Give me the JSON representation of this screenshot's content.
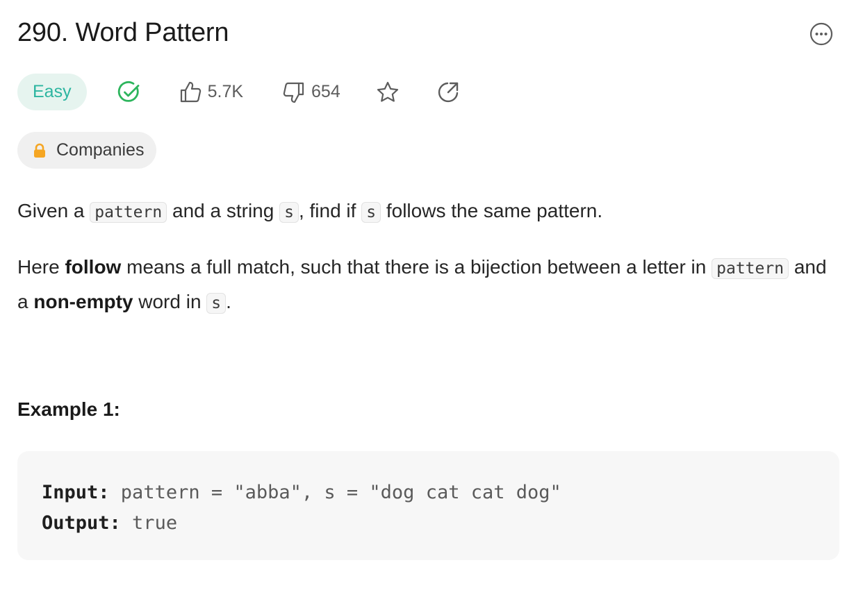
{
  "problem": {
    "title": "290. Word Pattern",
    "difficulty": "Easy",
    "likes": "5.7K",
    "dislikes": "654",
    "companies_label": "Companies"
  },
  "description": {
    "p1": {
      "t1": "Given a ",
      "c1": "pattern",
      "t2": " and a string ",
      "c2": "s",
      "t3": ", find if ",
      "c3": "s",
      "t4": " follows the same pattern."
    },
    "p2": {
      "t1": "Here ",
      "b1": "follow",
      "t2": " means a full match, such that there is a bijection between a letter in ",
      "c1": "pattern",
      "t3": " and a ",
      "b2": "non-empty",
      "t4": " word in ",
      "c2": "s",
      "t5": "."
    }
  },
  "example": {
    "heading": "Example 1:",
    "input_label": "Input:",
    "input_value": " pattern = \"abba\", s = \"dog cat cat dog\"",
    "output_label": "Output:",
    "output_value": " true"
  },
  "colors": {
    "easy": "#2cb5a0",
    "easy_bg": "#e6f4ef",
    "solved": "#2db55d",
    "lock": "#f5a623"
  },
  "icons": [
    "more-icon",
    "solved-check-icon",
    "thumbs-up-icon",
    "thumbs-down-icon",
    "star-icon",
    "share-icon",
    "lock-icon"
  ]
}
